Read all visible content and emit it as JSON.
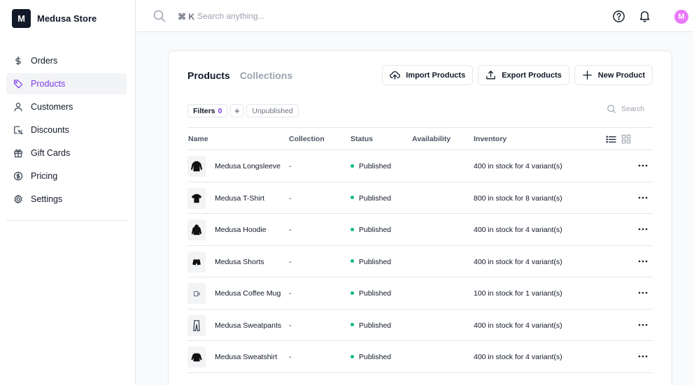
{
  "brand": {
    "logo_letter": "M",
    "name": "Medusa Store"
  },
  "sidebar": {
    "items": [
      {
        "label": "Orders",
        "icon": "dollar-icon",
        "active": false
      },
      {
        "label": "Products",
        "icon": "tag-icon",
        "active": true
      },
      {
        "label": "Customers",
        "icon": "user-icon",
        "active": false
      },
      {
        "label": "Discounts",
        "icon": "discount-icon",
        "active": false
      },
      {
        "label": "Gift Cards",
        "icon": "gift-icon",
        "active": false
      },
      {
        "label": "Pricing",
        "icon": "coin-icon",
        "active": false
      },
      {
        "label": "Settings",
        "icon": "gear-icon",
        "active": false
      }
    ]
  },
  "topbar": {
    "shortcut": "⌘ K",
    "search_placeholder": "Search anything...",
    "avatar_letter": "M"
  },
  "tabs": [
    {
      "label": "Products",
      "active": true
    },
    {
      "label": "Collections",
      "active": false
    }
  ],
  "actions": {
    "import_label": "Import Products",
    "export_label": "Export Products",
    "new_label": "New Product"
  },
  "filters": {
    "label": "Filters",
    "count": "0",
    "add": "+",
    "unpublished_label": "Unpublished",
    "search_placeholder": "Search"
  },
  "table": {
    "columns": {
      "name": "Name",
      "collection": "Collection",
      "status": "Status",
      "availability": "Availability",
      "inventory": "Inventory"
    },
    "rows": [
      {
        "name": "Medusa Longsleeve",
        "collection": "-",
        "status": "Published",
        "availability": "",
        "inventory": "400 in stock for 4 variant(s)"
      },
      {
        "name": "Medusa T-Shirt",
        "collection": "-",
        "status": "Published",
        "availability": "",
        "inventory": "800 in stock for 8 variant(s)"
      },
      {
        "name": "Medusa Hoodie",
        "collection": "-",
        "status": "Published",
        "availability": "",
        "inventory": "400 in stock for 4 variant(s)"
      },
      {
        "name": "Medusa Shorts",
        "collection": "-",
        "status": "Published",
        "availability": "",
        "inventory": "400 in stock for 4 variant(s)"
      },
      {
        "name": "Medusa Coffee Mug",
        "collection": "-",
        "status": "Published",
        "availability": "",
        "inventory": "100 in stock for 1 variant(s)"
      },
      {
        "name": "Medusa Sweatpants",
        "collection": "-",
        "status": "Published",
        "availability": "",
        "inventory": "400 in stock for 4 variant(s)"
      },
      {
        "name": "Medusa Sweatshirt",
        "collection": "-",
        "status": "Published",
        "availability": "",
        "inventory": "400 in stock for 4 variant(s)"
      }
    ]
  },
  "colors": {
    "accent": "#7c3aed",
    "published_dot": "#10b981",
    "avatar": "#e879f9"
  }
}
